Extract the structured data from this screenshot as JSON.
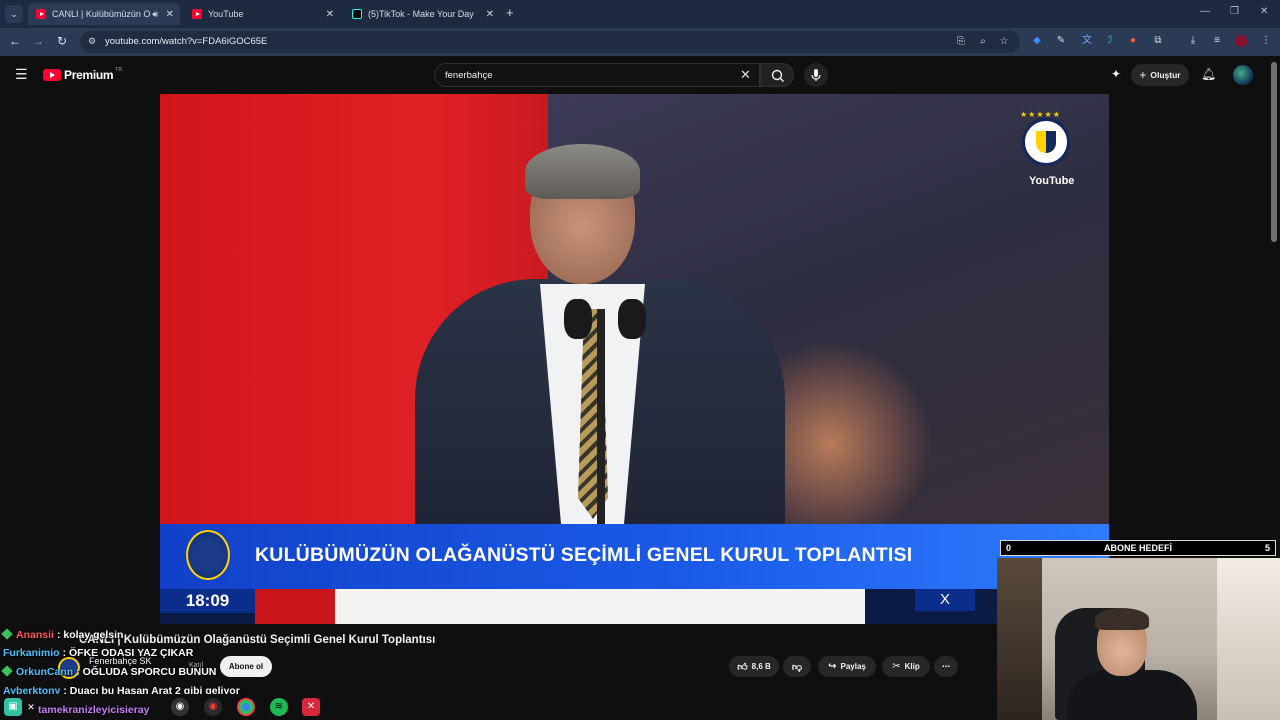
{
  "browser": {
    "tabs": [
      {
        "title": "CANLI | Kulübümüzün O",
        "active": true
      },
      {
        "title": "YouTube",
        "active": false
      },
      {
        "title": "(5)TikTok - Make Your Day",
        "active": false
      }
    ],
    "url": "youtube.com/watch?v=FDA6iGOC65E"
  },
  "youtube": {
    "logo_word": "Premium",
    "logo_region": "TR",
    "search_value": "fenerbahçe",
    "create_label": "Oluştur"
  },
  "video": {
    "channel_logo_text": "YouTube",
    "lower_third_title": "KULÜBÜMÜZÜN OLAĞANÜSTÜ SEÇİMLİ GENEL KURUL TOPLANTISI",
    "clock": "18:09",
    "social_icon": "X"
  },
  "goal": {
    "left": "0",
    "label": "ABONE HEDEFİ",
    "right": "5"
  },
  "chat": [
    {
      "user": "Anansii",
      "color": "#ff5a5a",
      "text": ": kolay gelsin",
      "gem": true
    },
    {
      "user": "Furkanimio",
      "color": "#4cc3ff",
      "text": ": ÖFKE ODASI YAZ ÇIKAR",
      "gem": false
    },
    {
      "user": "OrkunCann",
      "color": "#4cc3ff",
      "text": ": OĞLUDA SPORCU BUNUN",
      "gem": true
    },
    {
      "user": "Ayberktony",
      "color": "#4cc3ff",
      "text": ": Duacı bu Hasan Arat 2 gibi geliyor",
      "gem": false
    },
    {
      "user": "tamekranizleyicisieray",
      "color": "#c77dff",
      "text": "",
      "gem": false
    }
  ],
  "meta": {
    "title": "CANLI | Kulübümüzün Olağanüstü Seçimli Genel Kurul Toplantısı",
    "channel": "Fenerbahçe SK",
    "join_label": "Katıl",
    "subscribe_label": "Abone ol",
    "likes": "8,6 B",
    "share_label": "Paylaş",
    "clip_label": "Klip"
  }
}
